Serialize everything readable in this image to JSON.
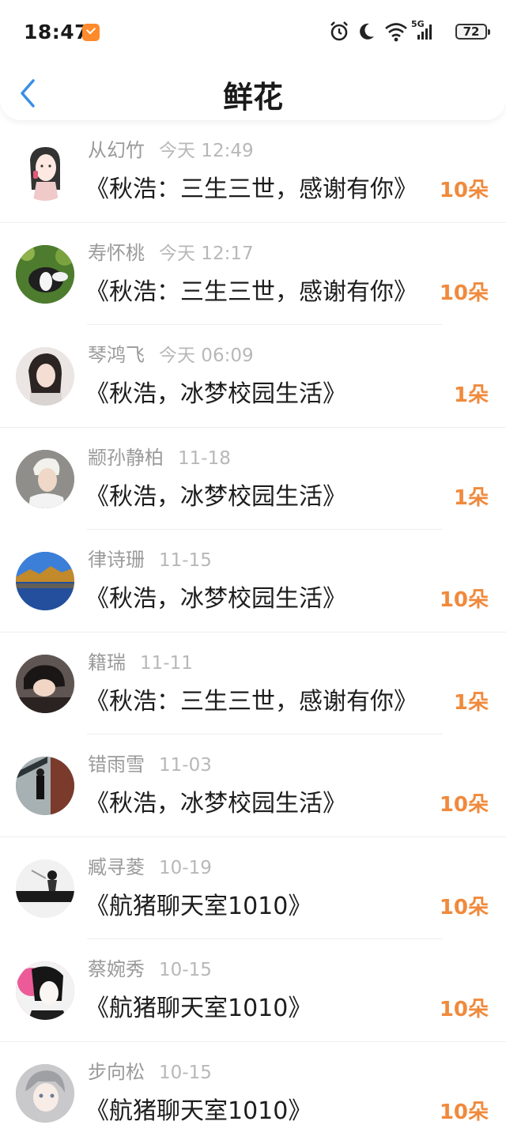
{
  "status_bar": {
    "time": "18:47",
    "network": "5G",
    "battery": "72"
  },
  "header": {
    "title": "鲜花"
  },
  "items": [
    {
      "name": "从幻竹",
      "date": "今天 12:49",
      "book": "《秋浩：三生三世，感谢有你》",
      "count": "10朵"
    },
    {
      "name": "寿怀桃",
      "date": "今天 12:17",
      "book": "《秋浩：三生三世，感谢有你》",
      "count": "10朵"
    },
    {
      "name": "琴鸿飞",
      "date": "今天 06:09",
      "book": "《秋浩，冰梦校园生活》",
      "count": "1朵"
    },
    {
      "name": "颛孙静柏",
      "date": "11-18",
      "book": "《秋浩，冰梦校园生活》",
      "count": "1朵"
    },
    {
      "name": "律诗珊",
      "date": "11-15",
      "book": "《秋浩，冰梦校园生活》",
      "count": "10朵"
    },
    {
      "name": "籍瑞",
      "date": "11-11",
      "book": "《秋浩：三生三世，感谢有你》",
      "count": "1朵"
    },
    {
      "name": "错雨雪",
      "date": "11-03",
      "book": "《秋浩，冰梦校园生活》",
      "count": "10朵"
    },
    {
      "name": "臧寻菱",
      "date": "10-19",
      "book": "《航猪聊天室1010》",
      "count": "10朵"
    },
    {
      "name": "蔡婉秀",
      "date": "10-15",
      "book": "《航猪聊天室1010》",
      "count": "10朵"
    },
    {
      "name": "步向松",
      "date": "10-15",
      "book": "《航猪聊天室1010》",
      "count": "10朵"
    }
  ],
  "colors": {
    "accent": "#3a8ee6",
    "count": "#f08a3c",
    "meta": "#9a9a9a"
  }
}
